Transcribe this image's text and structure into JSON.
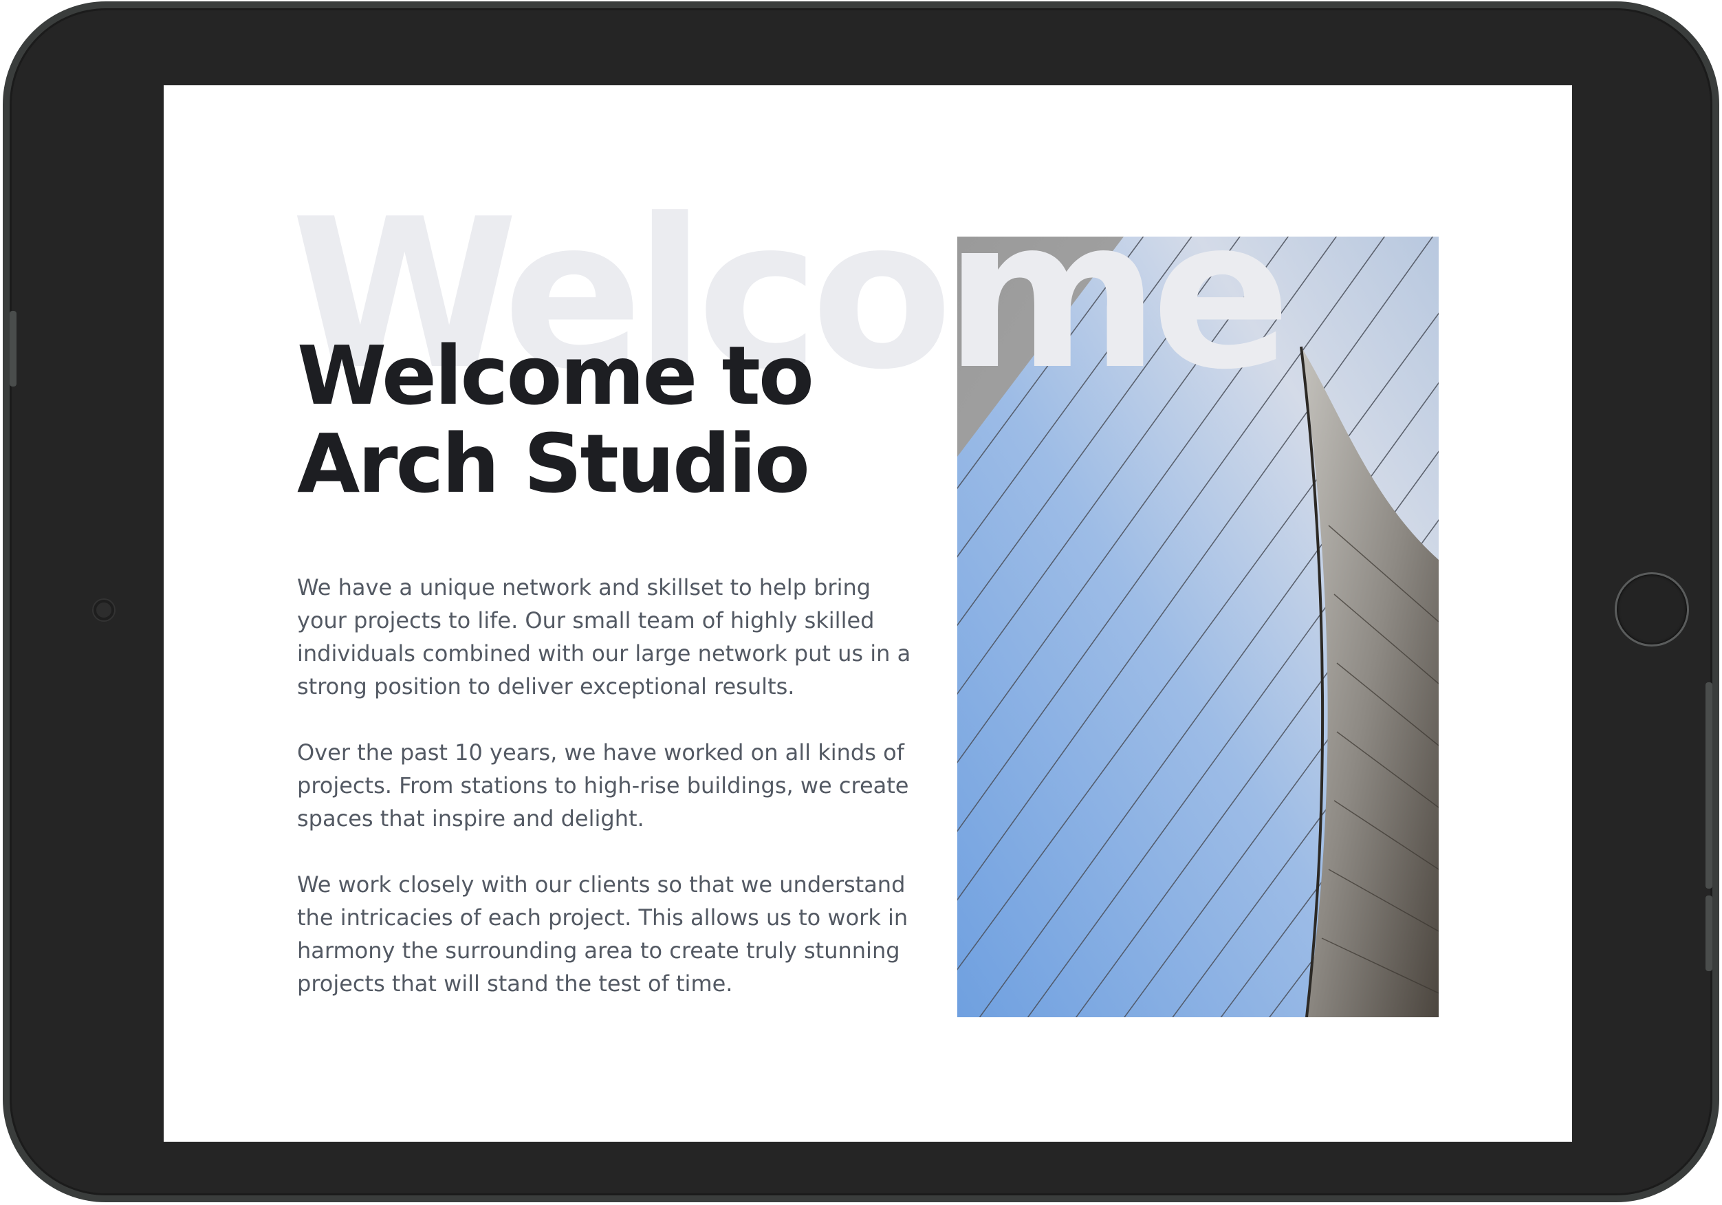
{
  "hero": {
    "watermark": "Welcome",
    "headline_line1": "Welcome to",
    "headline_line2": "Arch Studio",
    "paragraphs": [
      "We have a unique network and skillset to help bring your projects to life. Our small team of highly skilled individuals combined with our large network put us in a strong position to deliver exceptional results.",
      "Over the past 10 years, we have worked on all kinds of projects. From stations to high-rise buildings, we create spaces that inspire and delight.",
      "We work closely with our clients so that we understand the intricacies of each project. This allows us to work in harmony the surrounding area to create truly stunning projects that will stand the test of time."
    ],
    "image_icon": "architecture-photo-icon"
  },
  "colors": {
    "headline": "#1d1e22",
    "body": "#535963",
    "watermark": "#ebecf0",
    "bezel": "#252525",
    "screen": "#ffffff"
  }
}
